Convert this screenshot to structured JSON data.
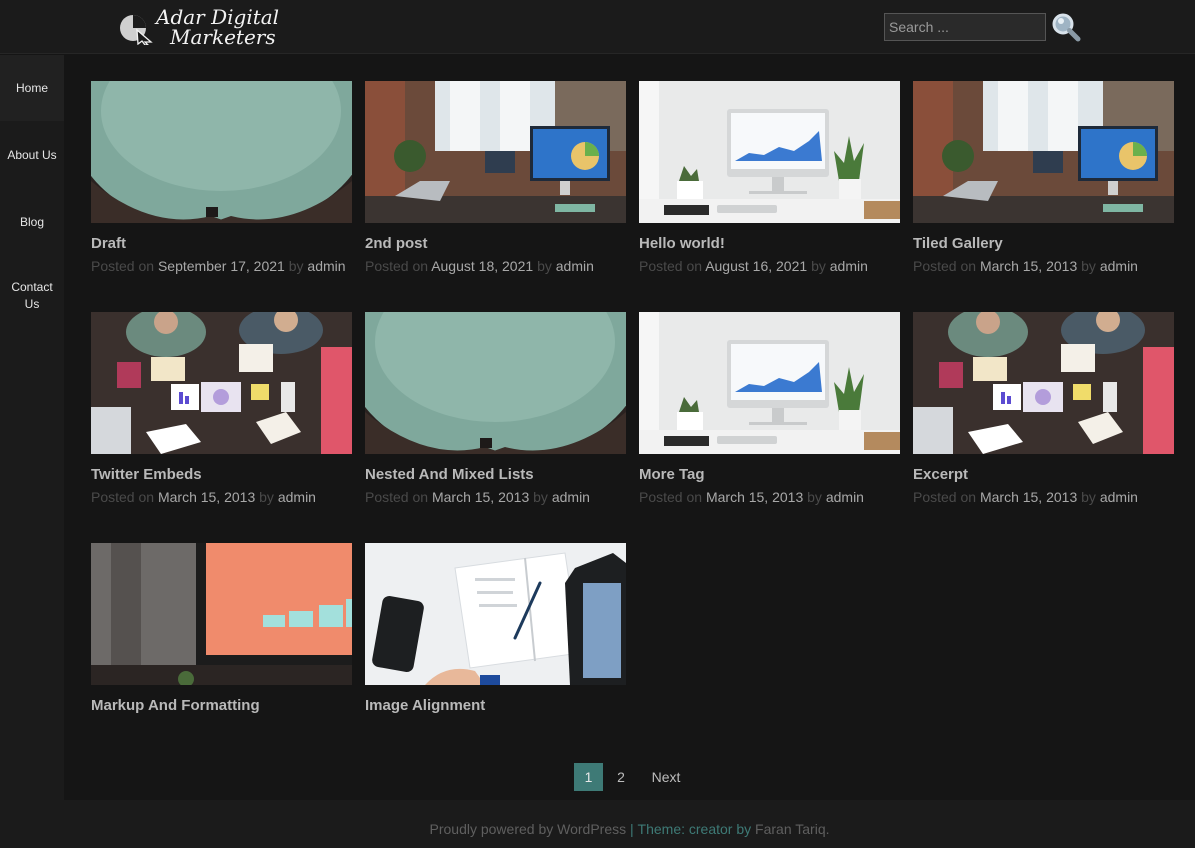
{
  "site": {
    "logo_line1": "Adar Digital",
    "logo_line2": "Marketers"
  },
  "search": {
    "placeholder": "Search ...",
    "icon": "magnifier-icon"
  },
  "nav": [
    {
      "label": "Home",
      "active": true
    },
    {
      "label": "About Us"
    },
    {
      "label": "Blog"
    },
    {
      "label": "Contact Us"
    }
  ],
  "meta_labels": {
    "posted_on": "Posted on",
    "by": "by"
  },
  "posts": [
    {
      "title": "Draft",
      "date": "September 17, 2021",
      "author": "admin",
      "image": "fabric-closeup"
    },
    {
      "title": "2nd post",
      "date": "August 18, 2021",
      "author": "admin",
      "image": "office-desk-monitor"
    },
    {
      "title": "Hello world!",
      "date": "August 16, 2021",
      "author": "admin",
      "image": "imac-chart-desk"
    },
    {
      "title": "Tiled Gallery",
      "date": "March 15, 2013",
      "author": "admin",
      "image": "office-desk-monitor"
    },
    {
      "title": "Twitter Embeds",
      "date": "March 15, 2013",
      "author": "admin",
      "image": "team-meeting-topdown"
    },
    {
      "title": "Nested And Mixed Lists",
      "date": "March 15, 2013",
      "author": "admin",
      "image": "fabric-closeup"
    },
    {
      "title": "More Tag",
      "date": "March 15, 2013",
      "author": "admin",
      "image": "imac-chart-desk"
    },
    {
      "title": "Excerpt",
      "date": "March 15, 2013",
      "author": "admin",
      "image": "team-meeting-topdown"
    },
    {
      "title": "Markup And Formatting",
      "image": "monitor-bar-chart"
    },
    {
      "title": "Image Alignment",
      "image": "phone-notebook-tablet"
    }
  ],
  "pagination": {
    "current": "1",
    "next_page": "2",
    "next_label": "Next"
  },
  "footer": {
    "powered": "Proudly powered by WordPress",
    "sep": " | ",
    "theme": "Theme: creator",
    "by": " by ",
    "author": "Faran Tariq."
  },
  "colors": {
    "accent": "#3e7a76",
    "background": "#151515",
    "panel": "#1b1b1b"
  }
}
